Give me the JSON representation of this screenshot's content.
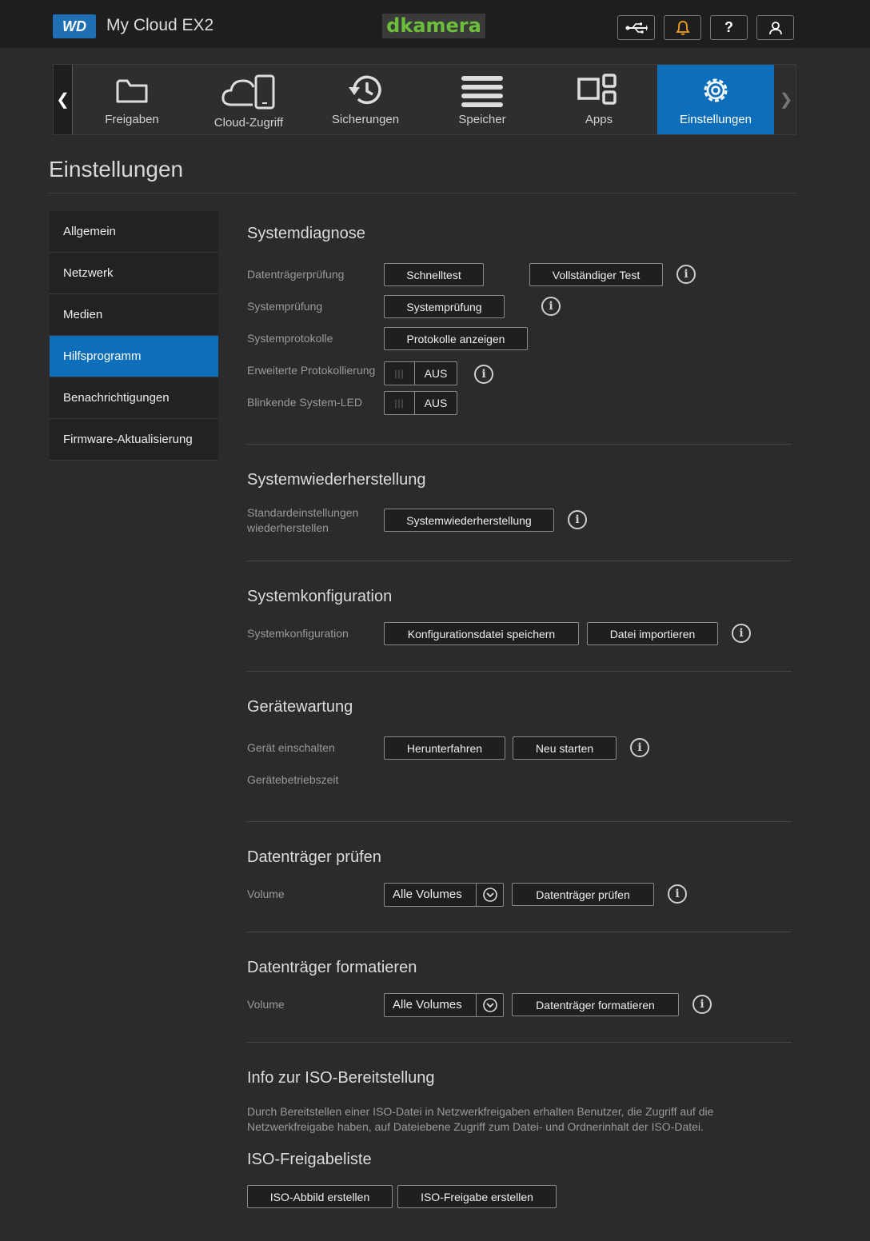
{
  "header": {
    "logo": "WD",
    "product": "My Cloud EX2",
    "brand": "dkamera"
  },
  "nav": {
    "items": [
      {
        "label": "Freigaben",
        "icon": "folder-icon"
      },
      {
        "label": "Cloud-Zugriff",
        "icon": "cloud-device-icon"
      },
      {
        "label": "Sicherungen",
        "icon": "history-icon"
      },
      {
        "label": "Speicher",
        "icon": "storage-icon"
      },
      {
        "label": "Apps",
        "icon": "apps-icon"
      },
      {
        "label": "Einstellungen",
        "icon": "gear-icon"
      }
    ],
    "active": "Einstellungen"
  },
  "page": {
    "title": "Einstellungen"
  },
  "sidebar": {
    "items": [
      {
        "label": "Allgemein"
      },
      {
        "label": "Netzwerk"
      },
      {
        "label": "Medien"
      },
      {
        "label": "Hilfsprogramm"
      },
      {
        "label": "Benachrichtigungen"
      },
      {
        "label": "Firmware-Aktualisierung"
      }
    ],
    "active": "Hilfsprogramm"
  },
  "diagnose": {
    "title": "Systemdiagnose",
    "disk_label": "Datenträgerprüfung",
    "quick_test": "Schnelltest",
    "full_test": "Vollständiger Test",
    "system_label": "Systemprüfung",
    "system_button": "Systemprüfung",
    "logs_label": "Systemprotokolle",
    "logs_button": "Protokolle anzeigen",
    "extended_label": "Erweiterte Protokollierung",
    "extended_state": "AUS",
    "led_label": "Blinkende System-LED",
    "led_state": "AUS"
  },
  "restore": {
    "title": "Systemwiederherstellung",
    "label_line1": "Standardeinstellungen",
    "label_line2": "wiederherstellen",
    "button": "Systemwiederherstellung"
  },
  "config": {
    "title": "Systemkonfiguration",
    "label": "Systemkonfiguration",
    "save_button": "Konfigurationsdatei speichern",
    "import_button": "Datei importieren"
  },
  "maintenance": {
    "title": "Gerätewartung",
    "power_label": "Gerät einschalten",
    "shutdown_button": "Herunterfahren",
    "restart_button": "Neu starten",
    "uptime_label": "Gerätebetriebszeit"
  },
  "check_disk": {
    "title": "Datenträger prüfen",
    "volume_label": "Volume",
    "volume_value": "Alle Volumes",
    "button": "Datenträger prüfen"
  },
  "format_disk": {
    "title": "Datenträger formatieren",
    "volume_label": "Volume",
    "volume_value": "Alle Volumes",
    "button": "Datenträger formatieren"
  },
  "iso": {
    "title": "Info zur ISO-Bereitstellung",
    "description": "Durch Bereitstellen einer ISO-Datei in Netzwerkfreigaben erhalten Benutzer, die Zugriff auf die Netzwerkfreigabe haben, auf Dateiebene Zugriff zum Datei- und Ordnerinhalt der ISO-Datei.",
    "list_title": "ISO-Freigabeliste",
    "create_image_button": "ISO-Abbild erstellen",
    "create_share_button": "ISO-Freigabe erstellen"
  },
  "colors": {
    "accent": "#0d6eba",
    "background": "#2b2b2b",
    "header": "#1e1e1e",
    "brand_green": "#6cbf3a",
    "alert_orange": "#f0a020"
  }
}
